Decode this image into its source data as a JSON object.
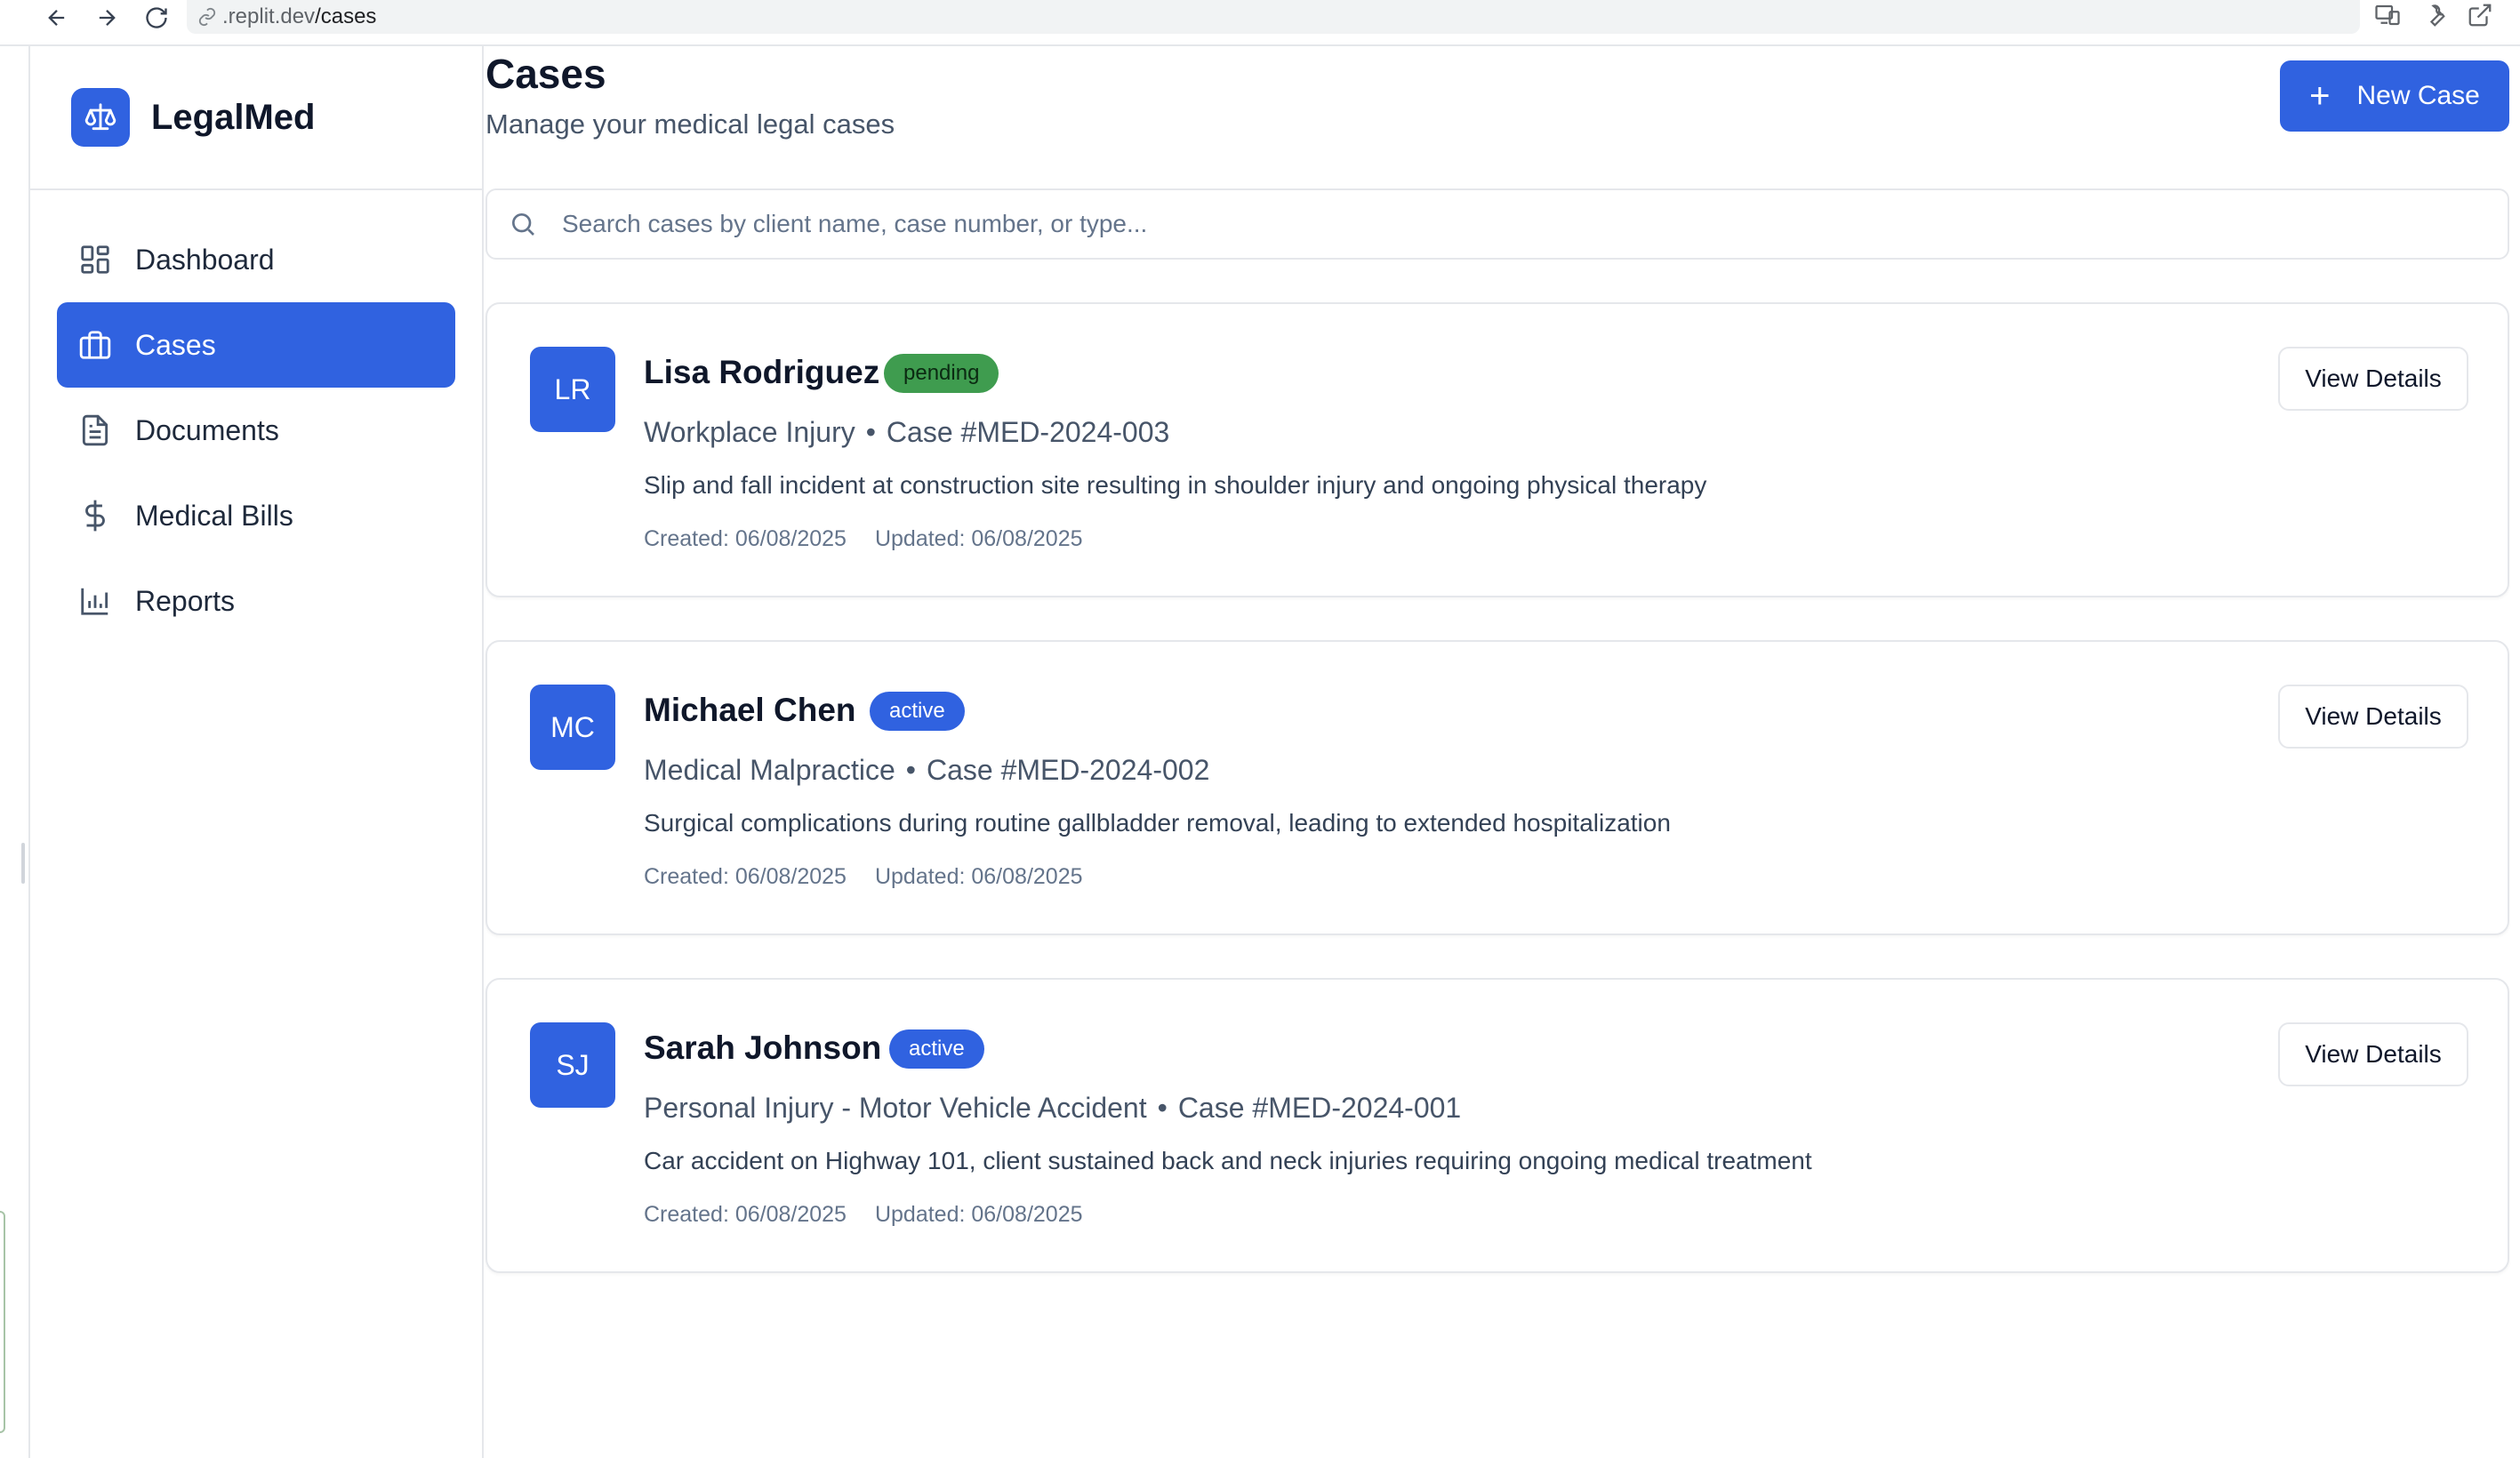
{
  "browser": {
    "url_host": ".replit.dev",
    "url_path": "/cases"
  },
  "brand": {
    "name": "LegalMed"
  },
  "sidebar": {
    "items": [
      {
        "label": "Dashboard",
        "icon": "dashboard-icon",
        "active": false
      },
      {
        "label": "Cases",
        "icon": "briefcase-icon",
        "active": true
      },
      {
        "label": "Documents",
        "icon": "document-icon",
        "active": false
      },
      {
        "label": "Medical Bills",
        "icon": "dollar-icon",
        "active": false
      },
      {
        "label": "Reports",
        "icon": "bar-chart-icon",
        "active": false
      }
    ]
  },
  "header": {
    "title": "Cases",
    "subtitle": "Manage your medical legal cases",
    "new_case_label": "New Case"
  },
  "search": {
    "placeholder": "Search cases by client name, case number, or type..."
  },
  "cases": [
    {
      "initials": "LR",
      "client": "Lisa Rodriguez",
      "status": "pending",
      "status_color": "#3f9c4f",
      "type": "Workplace Injury",
      "number": "Case #MED-2024-003",
      "description": "Slip and fall incident at construction site resulting in shoulder injury and ongoing physical therapy",
      "created": "Created: 06/08/2025",
      "updated": "Updated: 06/08/2025",
      "action": "View Details"
    },
    {
      "initials": "MC",
      "client": "Michael Chen",
      "status": "active",
      "status_color": "#3062e0",
      "type": "Medical Malpractice",
      "number": "Case #MED-2024-002",
      "description": "Surgical complications during routine gallbladder removal, leading to extended hospitalization",
      "created": "Created: 06/08/2025",
      "updated": "Updated: 06/08/2025",
      "action": "View Details"
    },
    {
      "initials": "SJ",
      "client": "Sarah Johnson",
      "status": "active",
      "status_color": "#3062e0",
      "type": "Personal Injury - Motor Vehicle Accident",
      "number": "Case #MED-2024-001",
      "description": "Car accident on Highway 101, client sustained back and neck injuries requiring ongoing medical treatment",
      "created": "Created: 06/08/2025",
      "updated": "Updated: 06/08/2025",
      "action": "View Details"
    }
  ],
  "colors": {
    "accent": "#3062e0",
    "pending": "#3f9c4f",
    "border": "#e5e7eb"
  }
}
